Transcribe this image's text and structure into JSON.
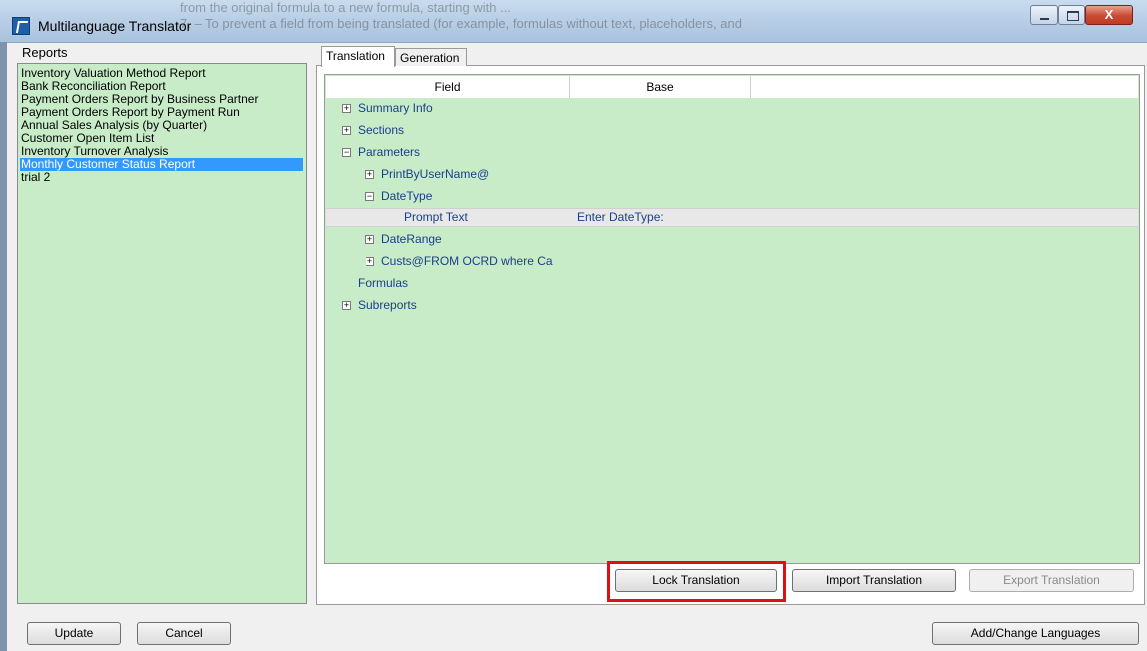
{
  "window": {
    "title": "Multilanguage Translator",
    "background_text": [
      "from the original formula to a new formula, starting with ...",
      "7. – To prevent a field from being translated (for example, formulas without text, placeholders, and"
    ],
    "close_symbol": "X"
  },
  "reports": {
    "label": "Reports",
    "items": [
      "Inventory Valuation Method Report",
      "Bank Reconciliation Report",
      "Payment Orders Report by Business Partner",
      "Payment Orders Report by Payment Run",
      "Annual Sales Analysis (by Quarter)",
      "Customer Open Item List",
      "Inventory Turnover Analysis",
      "Monthly Customer Status Report",
      "trial 2"
    ],
    "selected_index": 7
  },
  "tabs": [
    "Translation",
    "Generation"
  ],
  "grid": {
    "columns": [
      "Field",
      "Base"
    ],
    "rows": [
      {
        "label": "Summary Info",
        "expander": "+"
      },
      {
        "label": "Sections",
        "expander": "+"
      },
      {
        "label": "Parameters",
        "expander": "−"
      },
      {
        "label": "PrintByUserName@",
        "expander": "+"
      },
      {
        "label": "DateType",
        "expander": "−"
      },
      {
        "label": "Prompt Text",
        "value": "Enter DateType:"
      },
      {
        "label": "DateRange",
        "expander": "+"
      },
      {
        "label": "Custs@FROM OCRD where Ca",
        "expander": "+"
      },
      {
        "label": "Formulas",
        "expander": ""
      },
      {
        "label": "Subreports",
        "expander": "+"
      }
    ]
  },
  "buttons": {
    "lock": "Lock Translation",
    "import": "Import Translation",
    "export": "Export Translation",
    "update": "Update",
    "cancel": "Cancel",
    "languages": "Add/Change Languages"
  },
  "colors": {
    "list_bg": "#c8ecc8",
    "selection": "#3399ff",
    "highlight": "#e01010"
  }
}
